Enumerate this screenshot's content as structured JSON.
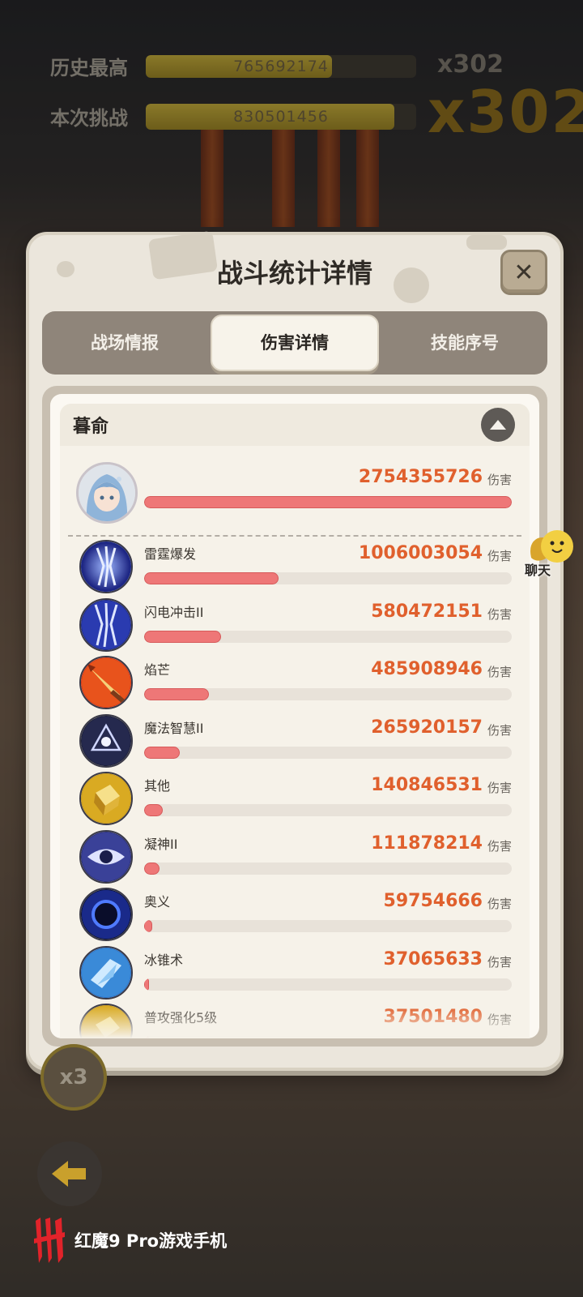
{
  "background": {
    "scores": [
      {
        "label": "历史最高",
        "value": "765692174",
        "fill": 0.69
      },
      {
        "label": "本次挑战",
        "value": "830501456",
        "fill": 0.92
      }
    ],
    "multiplier_small": "x302",
    "multiplier_big": "x302",
    "speed_label": "x3",
    "chat_label": "聊天",
    "watermark": "红魔9 Pro游戏手机"
  },
  "modal": {
    "title": "战斗统计详情",
    "close_icon": "close-icon",
    "tabs": [
      {
        "label": "战场情报",
        "active": false
      },
      {
        "label": "伤害详情",
        "active": true
      },
      {
        "label": "技能序号",
        "active": false
      }
    ],
    "hero": {
      "name": "暮俞",
      "total_damage": "2754355726",
      "unit": "伤害",
      "fill": 1.0
    },
    "skills": [
      {
        "name": "雷霆爆发",
        "damage": "1006003054",
        "unit": "伤害",
        "fill": 0.365,
        "icon": "lightning-burst-icon"
      },
      {
        "name": "闪电冲击II",
        "damage": "580472151",
        "unit": "伤害",
        "fill": 0.21,
        "icon": "lightning-strike-icon"
      },
      {
        "name": "焰芒",
        "damage": "485908946",
        "unit": "伤害",
        "fill": 0.176,
        "icon": "flame-blade-icon"
      },
      {
        "name": "魔法智慧II",
        "damage": "265920157",
        "unit": "伤害",
        "fill": 0.096,
        "icon": "magic-wisdom-icon"
      },
      {
        "name": "其他",
        "damage": "140846531",
        "unit": "伤害",
        "fill": 0.051,
        "icon": "gold-block-icon"
      },
      {
        "name": "凝神II",
        "damage": "111878214",
        "unit": "伤害",
        "fill": 0.041,
        "icon": "eye-focus-icon"
      },
      {
        "name": "奥义",
        "damage": "59754666",
        "unit": "伤害",
        "fill": 0.022,
        "icon": "arcane-orb-icon"
      },
      {
        "name": "冰锥术",
        "damage": "37065633",
        "unit": "伤害",
        "fill": 0.013,
        "icon": "ice-shard-icon"
      },
      {
        "name": "普攻强化5级",
        "damage": "37501480",
        "unit": "伤害",
        "fill": 0.013,
        "icon": "attack-boost-icon"
      }
    ]
  }
}
